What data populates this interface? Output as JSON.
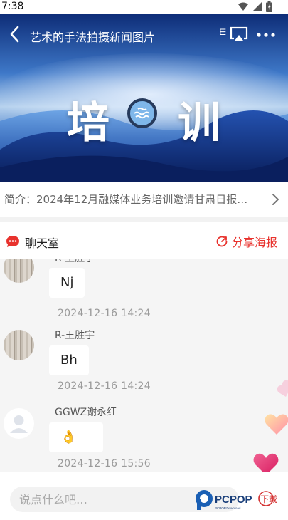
{
  "status_bar": {
    "time": "7:38"
  },
  "video": {
    "title": "艺术的手法拍摄新闻图片",
    "subtitle_glyph": "⋿",
    "banner_left": "培",
    "banner_right": "训"
  },
  "intro": {
    "text": "简介：2024年12月融媒体业务培训邀请甘肃日报…"
  },
  "chat": {
    "title": "聊天室",
    "share_label": "分享海报",
    "messages": [
      {
        "sender": "R-王胜宇",
        "text": "Nj",
        "time": "2024-12-16  14:24"
      },
      {
        "sender": "R-王胜宇",
        "text": "Bh",
        "time": "2024-12-16  14:24"
      },
      {
        "sender": "GGWZ谢永红",
        "text": "👌",
        "time": "2024-12-16  15:56"
      }
    ]
  },
  "input": {
    "placeholder": "说点什么吧…"
  },
  "watermark": {
    "brand": "PCPOP",
    "tag": "下载",
    "small": "PCPOP.Download"
  },
  "colors": {
    "accent": "#e8322d",
    "banner_dark": "#0d2a6e",
    "heart_pink": "#ec407a"
  }
}
